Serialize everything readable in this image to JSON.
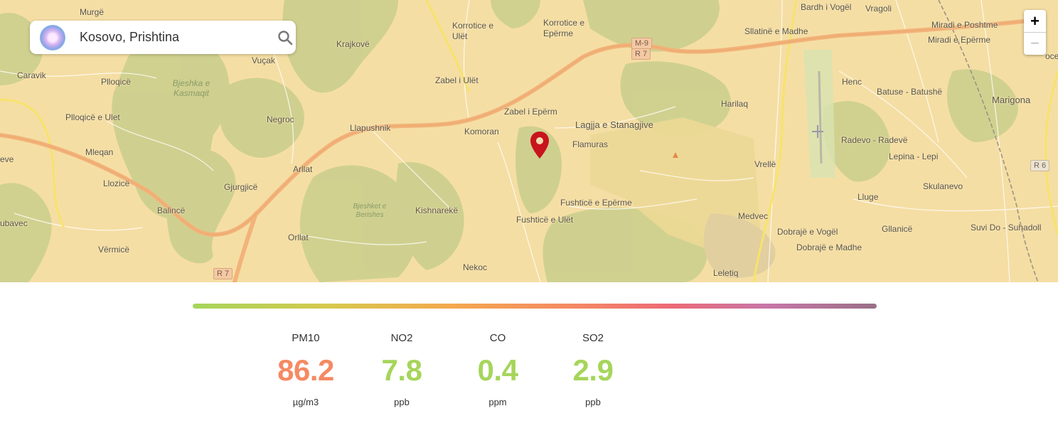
{
  "search": {
    "value": "Kosovo, Prishtina",
    "placeholder": ""
  },
  "zoom": {
    "in_label": "+",
    "out_label": "−"
  },
  "map": {
    "places": [
      "Murgë",
      "Caravik",
      "Plloqicë",
      "Plloqicë e Ulet",
      "Mleqan",
      "Llozicë",
      "Balincë",
      "ubavec",
      "Vërmicë",
      "Vuçak",
      "Krajkovë",
      "Negroc",
      "Llapushnik",
      "Arllat",
      "Gjurgjicë",
      "Orllat",
      "Kishnarekë",
      "Korrotice e Ulët",
      "Korrotice e Epërme",
      "Zabel i Ulët",
      "Zabel i Epërm",
      "Komoran",
      "Lagjja e Stanagjive",
      "Flamuras",
      "Fushticë e Epërme",
      "Fushticë e Ulët",
      "Nekoc",
      "Sllatinë e Madhe",
      "Bardh i Vogël",
      "Vragoli",
      "Miradi e Poshtme",
      "Miradi e Epërme",
      "Harilaq",
      "Henc",
      "Batuse - Batushë",
      "Marigona",
      "Vrellë",
      "Radevo - Radevë",
      "Lepina - Lepi",
      "Lluge",
      "Skulanevo",
      "Medvec",
      "Dobrajë e Vogël",
      "Gllanicë",
      "Suvi Do - Suhadoll",
      "Dobrajë e Madhe",
      "Leletiq",
      "eve",
      "oce"
    ],
    "forests": [
      "Bjeshka e Kasmaqit",
      "Bjeshket e Berishes"
    ],
    "road_shields": [
      "M-9",
      "R 7",
      "R 7",
      "R 6"
    ]
  },
  "accent_colors": {
    "pm10": "#f58a63",
    "good": "#a6d55b",
    "marker": "#c8141c"
  },
  "metrics": [
    {
      "name": "PM10",
      "value": "86.2",
      "unit": "µg/m3",
      "color": "#f58a63"
    },
    {
      "name": "NO2",
      "value": "7.8",
      "unit": "ppb",
      "color": "#a6d55b"
    },
    {
      "name": "CO",
      "value": "0.4",
      "unit": "ppm",
      "color": "#a6d55b"
    },
    {
      "name": "SO2",
      "value": "2.9",
      "unit": "ppb",
      "color": "#a6d55b"
    }
  ]
}
